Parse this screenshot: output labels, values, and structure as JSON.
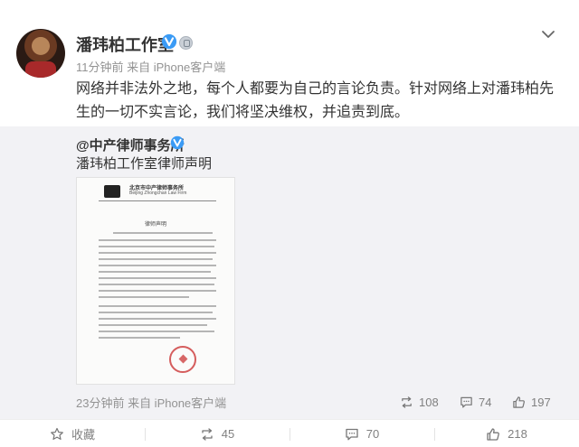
{
  "post": {
    "username": "潘玮柏工作室",
    "meta": "11分钟前  来自 iPhone客户端",
    "text": "网络并非法外之地，每个人都要为自己的言论负责。针对网络上对潘玮柏先生的一切不实言论，我们将坚决维权，并追责到底。"
  },
  "repost": {
    "author": "@中产律师事务所",
    "text": "潘玮柏工作室律师声明",
    "document": {
      "firm_cn": "北京市中产律师事务所",
      "firm_en": "Beijing Zhongchan Law Firm",
      "title": "律师声明"
    },
    "footer": "23分钟前  来自 iPhone客户端",
    "reposts": "108",
    "comments": "74",
    "likes": "197"
  },
  "actions": {
    "favorite": "收藏",
    "repost": "45",
    "comment": "70",
    "like": "218"
  },
  "colors": {
    "verified_blue": "#3b9bf5",
    "meta_gray": "#939393",
    "repost_bg": "#f2f2f5"
  },
  "icons": [
    "verified-icon",
    "medal-icon",
    "chevron-down-icon",
    "repost-icon",
    "comment-icon",
    "like-icon",
    "star-icon"
  ]
}
